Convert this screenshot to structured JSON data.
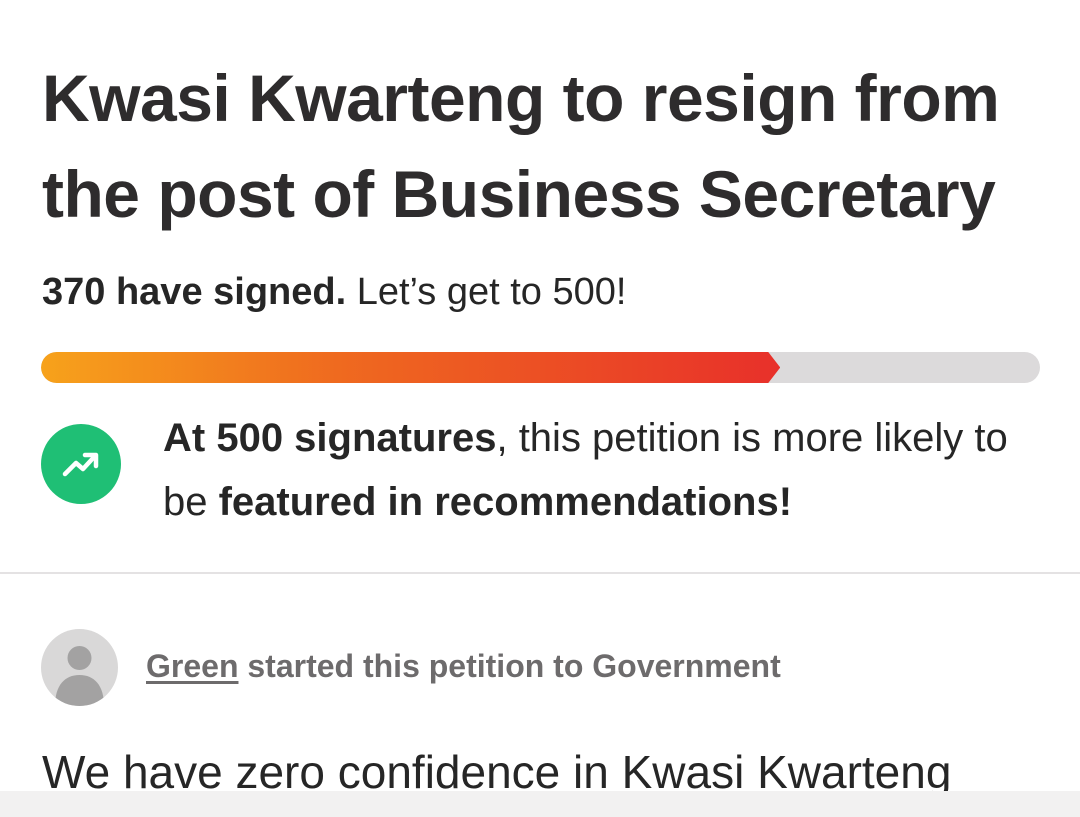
{
  "petition": {
    "title": "Kwasi Kwarteng to resign from the post of Business Secretary",
    "signed_bold": "370 have signed.",
    "signed_rest": " Let’s get to 500!",
    "signature_count": 370,
    "signature_goal": 500,
    "progress_fraction": 0.74
  },
  "milestone": {
    "icon": "trending-up-icon",
    "bold_1": "At 500 signatures",
    "text_1": ", this petition is more likely to be ",
    "bold_2": "featured in recommendations!"
  },
  "starter": {
    "name": "Green",
    "rest": " started this petition to Government"
  },
  "body": {
    "first_line": "We have zero confidence in Kwasi Kwarteng"
  },
  "colors": {
    "progress_start": "#f7a21b",
    "progress_end": "#e8302a",
    "milestone_icon_bg": "#1fbf75"
  }
}
